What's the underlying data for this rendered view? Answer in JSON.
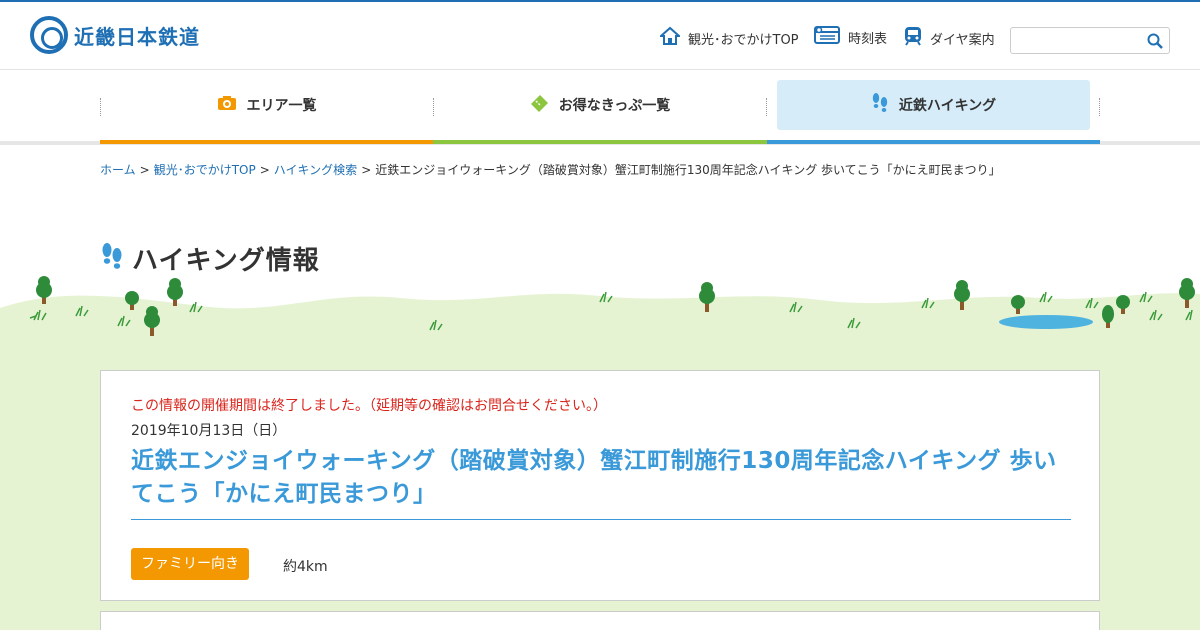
{
  "header": {
    "logo_text": "近畿日本鉄道",
    "nav": [
      {
        "label": "観光･おでかけTOP",
        "icon": "home-icon"
      },
      {
        "label": "時刻表",
        "icon": "timetable-icon"
      },
      {
        "label": "ダイヤ案内",
        "icon": "train-icon"
      }
    ],
    "search_placeholder": ""
  },
  "main_nav": {
    "items": [
      {
        "label": "エリア一覧",
        "icon": "camera-icon",
        "color": "#f39800"
      },
      {
        "label": "お得なきっぷ一覧",
        "icon": "ticket-icon",
        "color": "#8cc63f"
      },
      {
        "label": "近鉄ハイキング",
        "icon": "footprints-icon",
        "color": "#3a99d8",
        "active": true
      }
    ]
  },
  "breadcrumb": {
    "items": [
      "ホーム",
      "観光･おでかけTOP",
      "ハイキング検索"
    ],
    "current": "近鉄エンジョイウォーキング（踏破賞対象）蟹江町制施行130周年記念ハイキング 歩いてこう「かにえ町民まつり」",
    "separator": ">"
  },
  "page": {
    "title": "ハイキング情報"
  },
  "event": {
    "notice": "この情報の開催期間は終了しました。（延期等の確認はお問合せください。）",
    "date": "2019年10月13日（日）",
    "title": "近鉄エンジョイウォーキング（踏破賞対象）蟹江町制施行130周年記念ハイキング 歩いてこう「かにえ町民まつり」",
    "tag": "ファミリー向き",
    "distance": "約4km"
  },
  "colors": {
    "brand_blue": "#1e6fb4",
    "accent_blue": "#3a99d8",
    "orange": "#f39800",
    "green": "#8cc63f",
    "notice_red": "#d9251c",
    "grass": "#e6f3d3"
  }
}
